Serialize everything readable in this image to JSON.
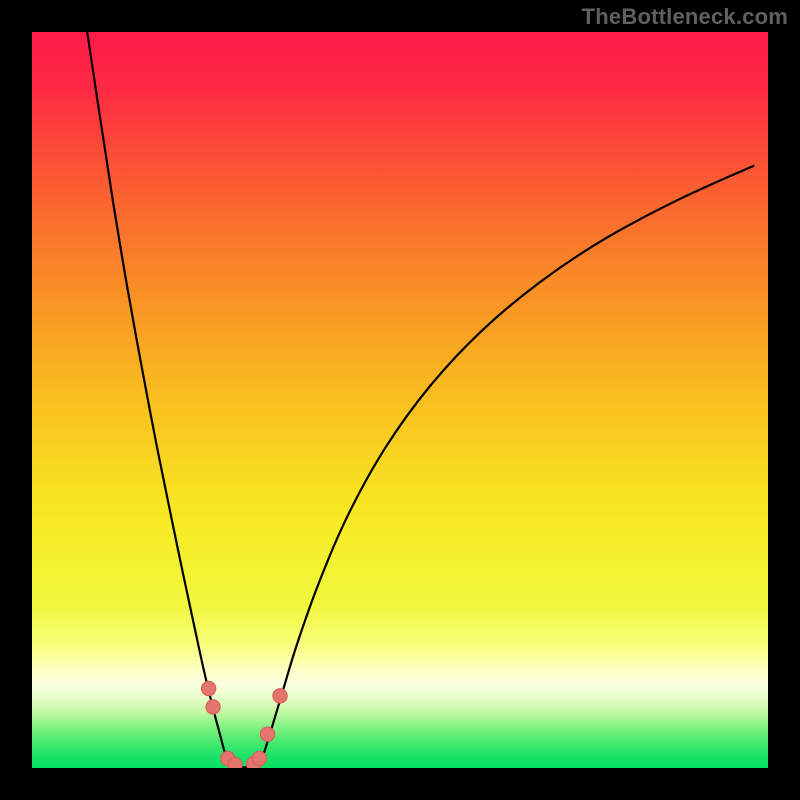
{
  "watermark": "TheBottleneck.com",
  "colors": {
    "black": "#000000",
    "watermark": "#606060",
    "curve": "#000000",
    "marker_fill": "#e3756d",
    "marker_stroke": "#d85a55",
    "gradient_stops": [
      {
        "offset": 0.0,
        "color": "#fd1b49"
      },
      {
        "offset": 0.08,
        "color": "#fd2b42"
      },
      {
        "offset": 0.2,
        "color": "#fb5a32"
      },
      {
        "offset": 0.35,
        "color": "#f98f25"
      },
      {
        "offset": 0.5,
        "color": "#f9bf1f"
      },
      {
        "offset": 0.65,
        "color": "#f8e823"
      },
      {
        "offset": 0.78,
        "color": "#f0f83d"
      },
      {
        "offset": 0.835,
        "color": "#f9fe7f"
      },
      {
        "offset": 0.865,
        "color": "#fdffc2"
      },
      {
        "offset": 0.885,
        "color": "#fbffe0"
      },
      {
        "offset": 0.905,
        "color": "#e8fecb"
      },
      {
        "offset": 0.925,
        "color": "#bef99f"
      },
      {
        "offset": 0.955,
        "color": "#62ed76"
      },
      {
        "offset": 0.985,
        "color": "#16e364"
      },
      {
        "offset": 1.0,
        "color": "#08e063"
      }
    ]
  },
  "chart_data": {
    "type": "line",
    "title": "",
    "xlabel": "",
    "ylabel": "",
    "xlim": [
      0,
      100
    ],
    "ylim": [
      0,
      100
    ],
    "grid": false,
    "legend": false,
    "series": [
      {
        "name": "left-branch",
        "x": [
          7.5,
          9,
          11,
          13,
          15,
          17,
          19,
          20.5,
          22,
          23.3,
          24.5,
          25.5,
          26.3,
          27
        ],
        "y": [
          100,
          90,
          77,
          65,
          54,
          43.5,
          33.7,
          26.5,
          19.5,
          13.5,
          8.5,
          4.7,
          1.8,
          0.25
        ]
      },
      {
        "name": "right-branch",
        "x": [
          30.8,
          31.5,
          32.5,
          34,
          36,
          39,
          43,
          48,
          54,
          61,
          69,
          78,
          88,
          98
        ],
        "y": [
          0.25,
          2.0,
          5.2,
          10.2,
          16.8,
          25.2,
          34.5,
          43.5,
          51.8,
          59.3,
          66,
          72,
          77.3,
          81.8
        ]
      },
      {
        "name": "valley-floor",
        "x": [
          27,
          28,
          29,
          30,
          30.8
        ],
        "y": [
          0.25,
          0.1,
          0.1,
          0.1,
          0.25
        ]
      }
    ],
    "markers": [
      {
        "x": 24.0,
        "y": 10.8
      },
      {
        "x": 24.6,
        "y": 8.3
      },
      {
        "x": 26.6,
        "y": 1.3
      },
      {
        "x": 27.6,
        "y": 0.45
      },
      {
        "x": 30.1,
        "y": 0.55
      },
      {
        "x": 30.9,
        "y": 1.3
      },
      {
        "x": 32.0,
        "y": 4.6
      },
      {
        "x": 33.7,
        "y": 9.8
      }
    ]
  }
}
